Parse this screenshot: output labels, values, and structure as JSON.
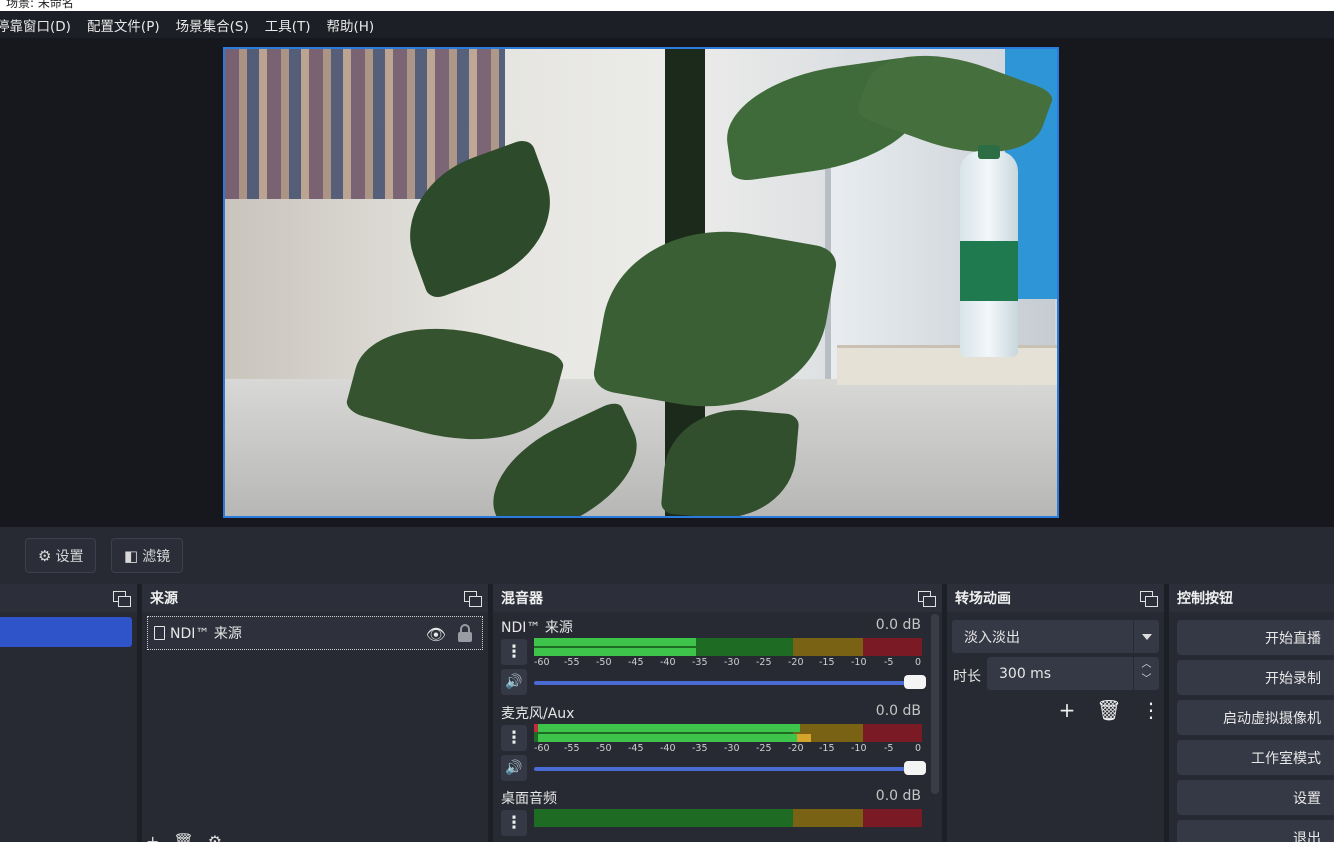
{
  "window": {
    "title": "场景: 未命名"
  },
  "menu": [
    "停靠窗口(D)",
    "配置文件(P)",
    "场景集合(S)",
    "工具(T)",
    "帮助(H)"
  ],
  "toolbar": {
    "settings_label": "设置",
    "filters_label": "滤镜"
  },
  "docks": {
    "sources": {
      "title": "来源",
      "items": [
        {
          "name": "NDI™ 来源",
          "visible": true,
          "locked": false
        }
      ]
    },
    "mixer": {
      "title": "混音器",
      "channels": [
        {
          "name": "NDI™ 来源",
          "db": "0.0 dB"
        },
        {
          "name": "麦克风/Aux",
          "db": "0.0 dB"
        },
        {
          "name": "桌面音频",
          "db": "0.0 dB"
        }
      ],
      "ticks": [
        "-60",
        "-55",
        "-50",
        "-45",
        "-40",
        "-35",
        "-30",
        "-25",
        "-20",
        "-15",
        "-10",
        "-5",
        "0"
      ]
    },
    "transitions": {
      "title": "转场动画",
      "selected": "淡入淡出",
      "duration_label": "时长",
      "duration_value": "300 ms"
    },
    "controls": {
      "title": "控制按钮",
      "buttons": [
        "开始直播",
        "开始录制",
        "启动虚拟摄像机",
        "工作室模式",
        "设置",
        "退出"
      ]
    }
  },
  "colors": {
    "accent": "#2f54c9",
    "meter_green": "#3ec44a",
    "meter_yellow": "#d4a52a",
    "meter_red": "#c42a3a",
    "volume_slider": "#4a6ad4"
  }
}
